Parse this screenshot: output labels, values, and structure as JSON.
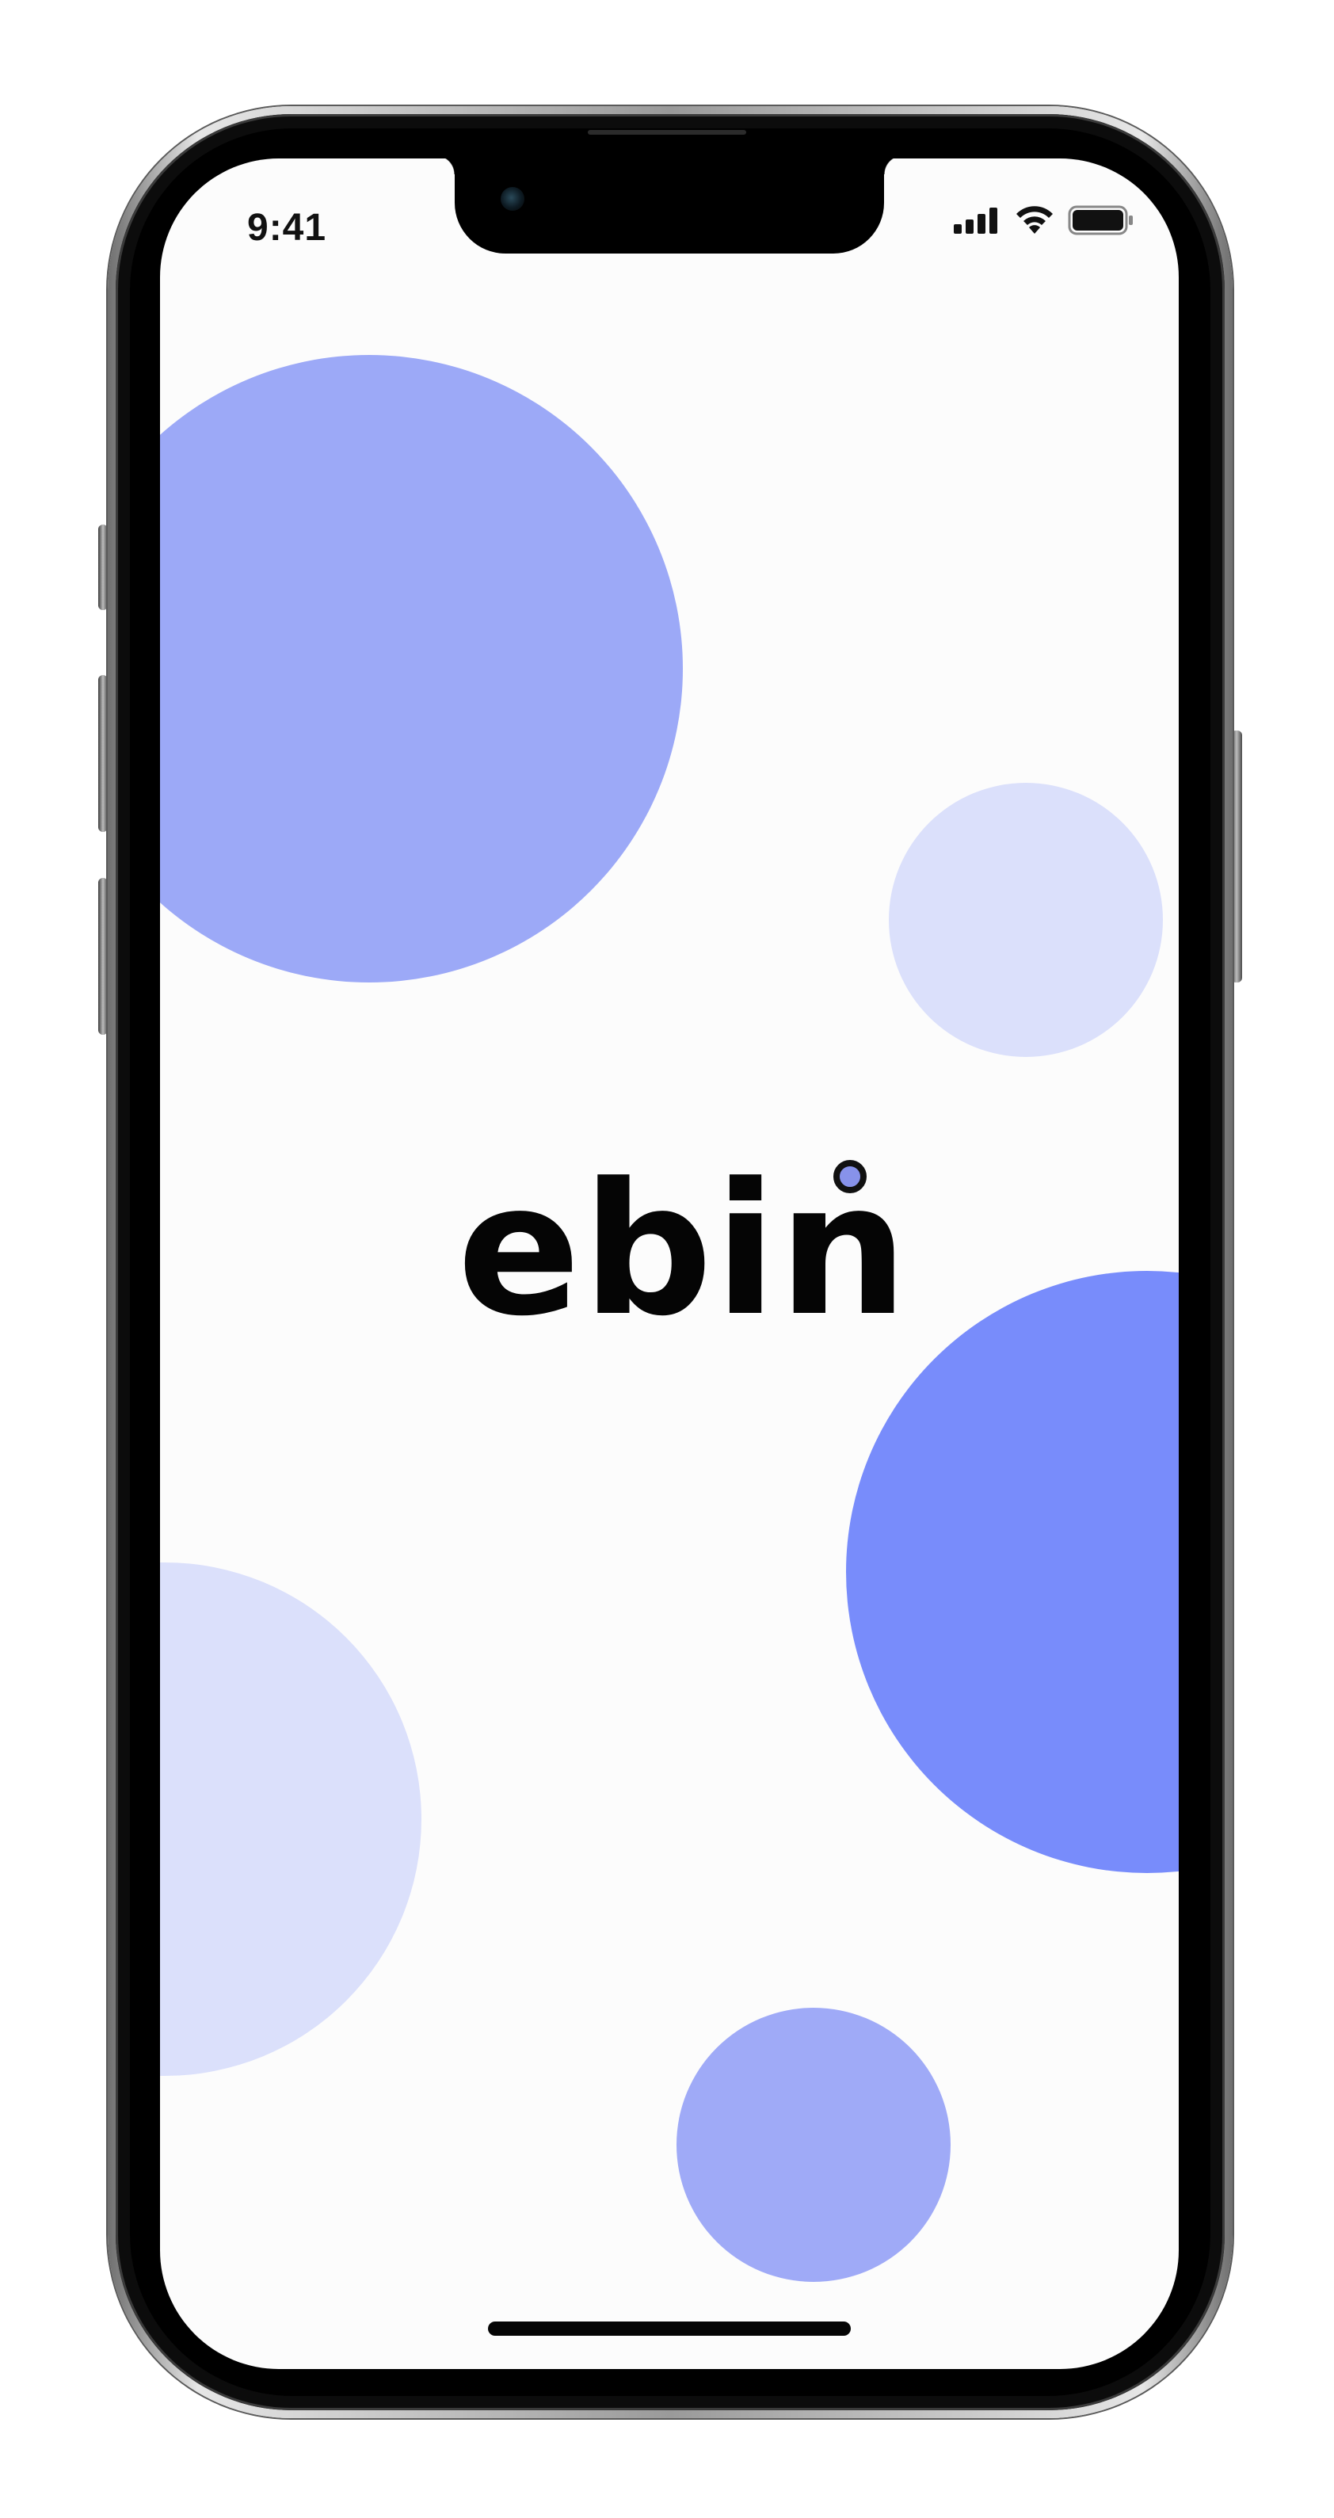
{
  "status_bar": {
    "time": "9:41",
    "signal_icon": "cellular-signal-icon",
    "wifi_icon": "wifi-icon",
    "battery_icon": "battery-icon",
    "battery_level": 1.0
  },
  "app": {
    "logo_text": "ebin",
    "logo_dot_icon": "logo-dot-icon"
  },
  "colors": {
    "accent_light": "#9ca9f7",
    "accent_pale": "#dbe0fb",
    "accent_strong": "#788cfb",
    "accent_soft": "#9faaf7",
    "logo_dot": "#8792ea",
    "background": "#fcfcfc"
  }
}
